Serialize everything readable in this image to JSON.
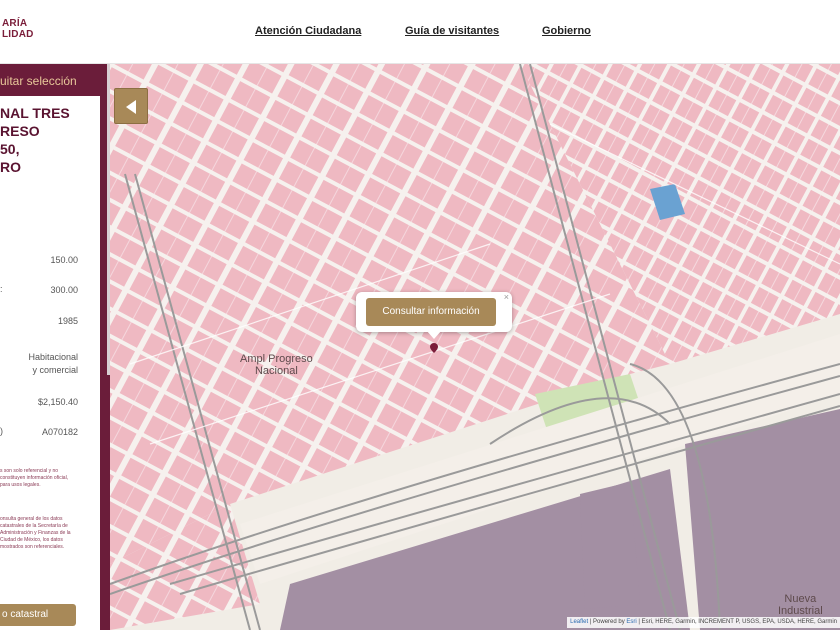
{
  "header": {
    "brand_line1": "ARÍA",
    "brand_line2": "LIDAD",
    "nav": [
      {
        "label": "Atención Ciudadana"
      },
      {
        "label": "Guía de visitantes"
      },
      {
        "label": "Gobierno"
      }
    ]
  },
  "sidebar": {
    "tab_label": "uitar selección",
    "title_lines": [
      "NAL TRES",
      "RESO",
      "50,",
      "RO"
    ],
    "fields": [
      {
        "key": "",
        "value": "150.00"
      },
      {
        "key": ":",
        "value": "300.00"
      },
      {
        "key": "",
        "value": "1985"
      },
      {
        "key": "",
        "value": "Habitacional"
      },
      {
        "key": "",
        "value": "y comercial"
      },
      {
        "key": "",
        "value": "$2,150.40"
      },
      {
        "key": ")",
        "value": "A070182"
      }
    ],
    "note_1": "s son solo referencial y no constituyen información oficial, para usos legales.",
    "note_2": "onsulta general de los datos catastrales de la Secretaría de Administración y Finanzas de la Ciudad de México, los datos mostrados son referenciales.",
    "catastral_button": "o catastral"
  },
  "map": {
    "collapse_button_icon": "chevron-left-icon",
    "popup_button": "Consultar información",
    "popup_close": "×",
    "neighborhood_label_1": "Ampl Progreso",
    "neighborhood_label_2": "Nacional",
    "industrial_label_1": "Nueva",
    "industrial_label_2": "Industrial",
    "attribution_leaflet": "Leaflet",
    "attribution_sep": " | Powered by ",
    "attribution_esri": "Esri",
    "attribution_rest": " | Esri, HERE, Garmin, INCREMENT P, USGS, EPA, USDA, HERE, Garmin",
    "colors": {
      "blocks": "#efb9c2",
      "streets": "#f6f1ee",
      "industrial": "#a38fa3",
      "park": "#cfe3b6",
      "highway": "#9a9a9a",
      "highlighted_lot": "#6aa2d2",
      "accent_gold": "#a88958",
      "sidebar_maroon": "#6b1d3a"
    }
  }
}
